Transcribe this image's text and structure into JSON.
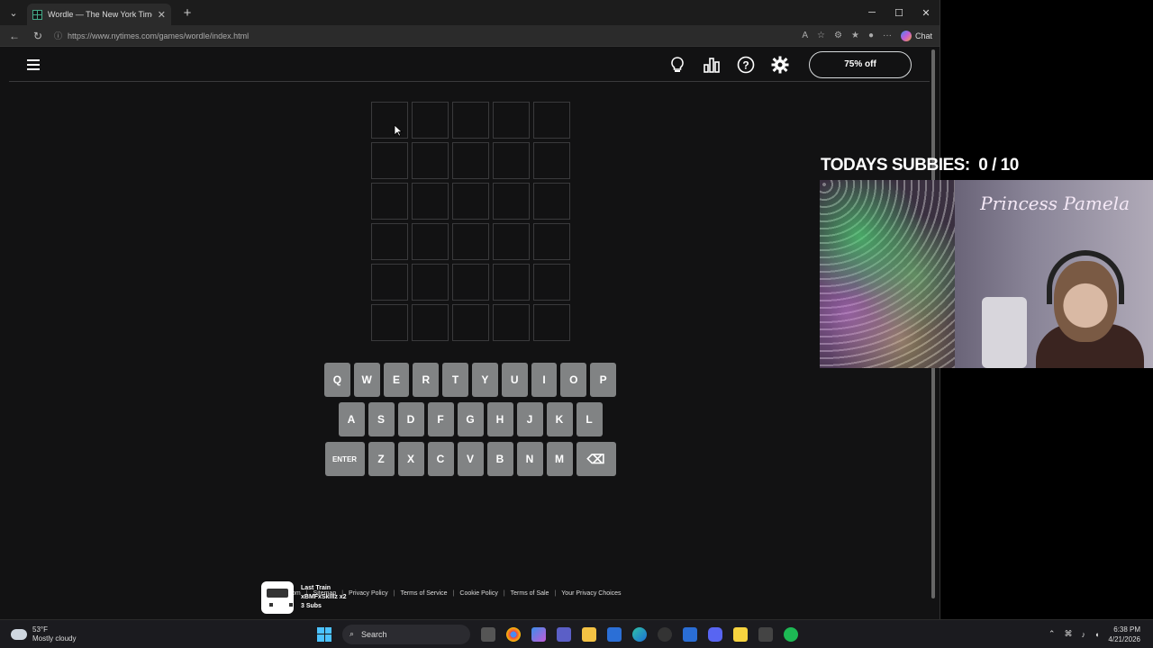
{
  "browser": {
    "tab_title": "Wordle — The New York Times",
    "url": "https://www.nytimes.com/games/wordle/index.html",
    "chat_label": "Chat"
  },
  "wordle": {
    "promo_label": "75% off",
    "keyboard_rows": [
      [
        "Q",
        "W",
        "E",
        "R",
        "T",
        "Y",
        "U",
        "I",
        "O",
        "P"
      ],
      [
        "A",
        "S",
        "D",
        "F",
        "G",
        "H",
        "J",
        "K",
        "L"
      ],
      [
        "ENTER",
        "Z",
        "X",
        "C",
        "V",
        "B",
        "N",
        "M",
        "⌫"
      ]
    ],
    "footer_links": [
      "NYTimes.com",
      "Sitemap",
      "Privacy Policy",
      "Terms of Service",
      "Cookie Policy",
      "Terms of Sale",
      "Your Privacy Choices"
    ]
  },
  "alert": {
    "title": "Last Train",
    "user": "xBMFxSkillz x2",
    "detail": "3 Subs"
  },
  "stream": {
    "subbies_label": "TODAYS SUBBIES:",
    "subbies_count": "0 / 10",
    "cam_name": "Princess Pamela"
  },
  "taskbar": {
    "temperature": "53°F",
    "weather": "Mostly cloudy",
    "search_label": "Search",
    "time": "6:38 PM",
    "date": "4/21/2026"
  }
}
